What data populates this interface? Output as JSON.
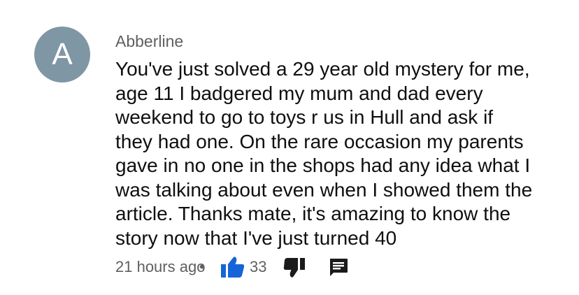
{
  "comment": {
    "avatar_letter": "A",
    "author": "Abberline",
    "body_lines": [
      "You've just solved a 29 year old mystery for me,",
      "age 11 I badgered my mum and dad every",
      "weekend to go to toys r us in Hull and ask if",
      "they had one. On the rare occasion my parents",
      "gave in no one in the shops had any idea what I",
      "was talking about even when I showed them the",
      "article. Thanks mate, it's amazing to know the",
      "story now that I've just turned 40"
    ],
    "timestamp": "21 hours ago",
    "separator": "•",
    "like_count": "33",
    "like_icon": "thumbs-up-icon",
    "dislike_icon": "thumbs-down-icon",
    "reply_icon": "reply-icon",
    "colors": {
      "avatar_bg": "#7f96a4",
      "like_active": "#1565d8",
      "icon_gray": "#606060",
      "text": "#0f0f0f"
    }
  }
}
